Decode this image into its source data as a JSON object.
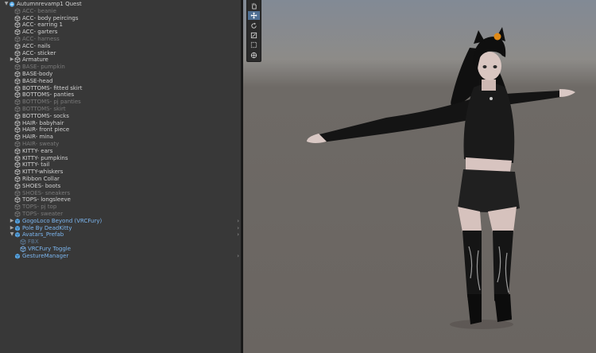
{
  "hierarchy": {
    "items": [
      {
        "label": "Autumnrevamp1 Quest",
        "depth": 0,
        "icon": "root-avatar-icon",
        "style": "normal",
        "expanded": true
      },
      {
        "label": "ACC- beanie",
        "depth": 1,
        "icon": "gameobject-icon",
        "style": "dim"
      },
      {
        "label": "ACC- body peircings",
        "depth": 1,
        "icon": "gameobject-icon",
        "style": "normal"
      },
      {
        "label": "ACC- earring 1",
        "depth": 1,
        "icon": "gameobject-icon",
        "style": "normal"
      },
      {
        "label": "ACC- garters",
        "depth": 1,
        "icon": "gameobject-icon",
        "style": "normal"
      },
      {
        "label": "ACC- harness",
        "depth": 1,
        "icon": "gameobject-icon",
        "style": "dim"
      },
      {
        "label": "ACC- nails",
        "depth": 1,
        "icon": "gameobject-icon",
        "style": "normal"
      },
      {
        "label": "ACC- sticker",
        "depth": 1,
        "icon": "gameobject-icon",
        "style": "normal"
      },
      {
        "label": "Armature",
        "depth": 1,
        "icon": "gameobject-icon",
        "style": "normal",
        "expanded": false
      },
      {
        "label": "BASE- pumpkin",
        "depth": 1,
        "icon": "gameobject-icon",
        "style": "dim"
      },
      {
        "label": "BASE-body",
        "depth": 1,
        "icon": "gameobject-icon",
        "style": "normal"
      },
      {
        "label": "BASE-head",
        "depth": 1,
        "icon": "gameobject-icon",
        "style": "normal"
      },
      {
        "label": "BOTTOMS- fitted skirt",
        "depth": 1,
        "icon": "gameobject-icon",
        "style": "normal"
      },
      {
        "label": "BOTTOMS- panties",
        "depth": 1,
        "icon": "gameobject-icon",
        "style": "normal"
      },
      {
        "label": "BOTTOMS- pj panties",
        "depth": 1,
        "icon": "gameobject-icon",
        "style": "dim"
      },
      {
        "label": "BOTTOMS- skirt",
        "depth": 1,
        "icon": "gameobject-icon",
        "style": "dim"
      },
      {
        "label": "BOTTOMS- socks",
        "depth": 1,
        "icon": "gameobject-icon",
        "style": "normal"
      },
      {
        "label": "HAIR- babyhair",
        "depth": 1,
        "icon": "gameobject-icon",
        "style": "normal"
      },
      {
        "label": "HAIR- front piece",
        "depth": 1,
        "icon": "gameobject-icon",
        "style": "normal"
      },
      {
        "label": "HAIR- mina",
        "depth": 1,
        "icon": "gameobject-icon",
        "style": "normal"
      },
      {
        "label": "HAIR- sweaty",
        "depth": 1,
        "icon": "gameobject-icon",
        "style": "dim"
      },
      {
        "label": "KITTY- ears",
        "depth": 1,
        "icon": "gameobject-icon",
        "style": "normal"
      },
      {
        "label": "KITTY- pumpkins",
        "depth": 1,
        "icon": "gameobject-icon",
        "style": "normal"
      },
      {
        "label": "KITTY- tail",
        "depth": 1,
        "icon": "gameobject-icon",
        "style": "normal"
      },
      {
        "label": "KITTY-whiskers",
        "depth": 1,
        "icon": "gameobject-icon",
        "style": "normal"
      },
      {
        "label": "Ribbon Collar",
        "depth": 1,
        "icon": "gameobject-icon",
        "style": "normal"
      },
      {
        "label": "SHOES- boots",
        "depth": 1,
        "icon": "gameobject-icon",
        "style": "normal"
      },
      {
        "label": "SHOES- sneakers",
        "depth": 1,
        "icon": "gameobject-icon",
        "style": "dim"
      },
      {
        "label": "TOPS- longsleeve",
        "depth": 1,
        "icon": "gameobject-icon",
        "style": "normal"
      },
      {
        "label": "TOPS- pj top",
        "depth": 1,
        "icon": "gameobject-icon",
        "style": "dim"
      },
      {
        "label": "TOPS- sweater",
        "depth": 1,
        "icon": "gameobject-icon",
        "style": "dim"
      },
      {
        "label": "GogoLoco Beyond (VRCFury)",
        "depth": 1,
        "icon": "prefab-icon",
        "style": "prefab",
        "expanded": false,
        "chevron": true
      },
      {
        "label": "Pole By DeadKitty",
        "depth": 1,
        "icon": "prefab-icon",
        "style": "prefab",
        "expanded": false,
        "chevron": true
      },
      {
        "label": "Avatars_Prefab",
        "depth": 1,
        "icon": "prefab-icon",
        "style": "prefab",
        "expanded": true,
        "chevron": true
      },
      {
        "label": "FBX",
        "depth": 2,
        "icon": "gameobject-icon",
        "style": "prefab-dim"
      },
      {
        "label": "VRCFury Toggle",
        "depth": 2,
        "icon": "gameobject-icon",
        "style": "prefab"
      },
      {
        "label": "GestureManager",
        "depth": 1,
        "icon": "prefab-icon",
        "style": "prefab",
        "chevron": true
      }
    ]
  },
  "toolbar": {
    "tools": [
      {
        "icon": "hand-tool-icon",
        "active": false
      },
      {
        "icon": "move-tool-icon",
        "active": true
      },
      {
        "icon": "rotate-tool-icon",
        "active": false
      },
      {
        "icon": "scale-tool-icon",
        "active": false
      },
      {
        "icon": "rect-tool-icon",
        "active": false
      },
      {
        "icon": "transform-tool-icon",
        "active": false
      }
    ]
  },
  "colors": {
    "panel_bg": "#383838",
    "text_normal": "#d2d2d2",
    "text_disabled": "#7a7a7a",
    "prefab_blue": "#7cb6f0",
    "active_tool": "#4e6e92"
  }
}
